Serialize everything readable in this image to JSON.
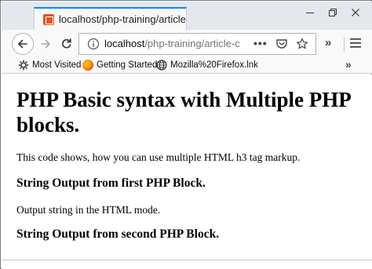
{
  "tab": {
    "title": "localhost/php-training/article-"
  },
  "navbar": {
    "url_host": "localhost",
    "url_path": "/php-training/article-c",
    "page_actions_label": "•••",
    "overflow_label": "»"
  },
  "bookmarks": {
    "items": [
      {
        "label": "Most Visited",
        "icon": "gear-icon"
      },
      {
        "label": "Getting Started",
        "icon": "firefox-icon"
      },
      {
        "label": "Mozilla%20Firefox.lnk",
        "icon": "globe-icon"
      }
    ],
    "overflow_label": "»"
  },
  "page": {
    "heading": "PHP Basic syntax with Multiple PHP blocks.",
    "intro": "This code shows, how you can use multiple HTML h3 tag markup.",
    "subheading_1": "String Output from first PHP Block.",
    "body_1": "Output string in the HTML mode.",
    "subheading_2": "String Output from second PHP Block."
  },
  "colors": {
    "tab_accent": "#0a84ff",
    "titlebar_bg": "#e4e7ec",
    "toolbar_bg": "#f9f9fa",
    "favicon": "#e2561f"
  }
}
